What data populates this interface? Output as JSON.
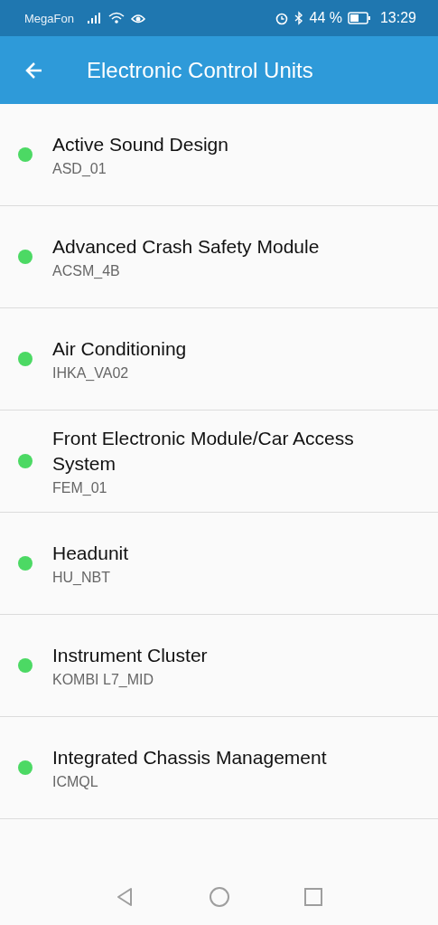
{
  "status_bar": {
    "carrier": "MegaFon",
    "battery_text": "44 %",
    "time": "13:29"
  },
  "app_bar": {
    "title": "Electronic Control Units"
  },
  "units": [
    {
      "name": "Active Sound Design",
      "code": "ASD_01",
      "color": "#4cd964"
    },
    {
      "name": "Advanced Crash Safety Module",
      "code": "ACSM_4B",
      "color": "#4cd964"
    },
    {
      "name": "Air Conditioning",
      "code": "IHKA_VA02",
      "color": "#4cd964"
    },
    {
      "name": "Front Electronic Module/Car Access System",
      "code": "FEM_01",
      "color": "#4cd964"
    },
    {
      "name": "Headunit",
      "code": "HU_NBT",
      "color": "#4cd964"
    },
    {
      "name": "Instrument Cluster",
      "code": "KOMBI L7_MID",
      "color": "#4cd964"
    },
    {
      "name": "Integrated Chassis Management",
      "code": "ICMQL",
      "color": "#4cd964"
    }
  ]
}
